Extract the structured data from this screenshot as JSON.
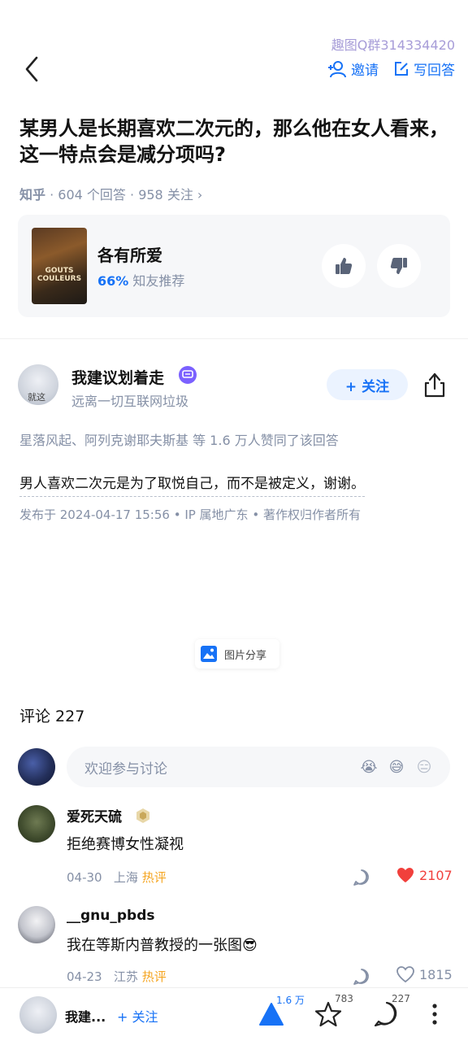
{
  "watermark": "趣图Q群314334420",
  "topbar": {
    "invite_label": "邀请",
    "write_answer_label": "写回答"
  },
  "question": {
    "title": "某男人是长期喜欢二次元的，那么他在女人看来，这一特点会是减分项吗?",
    "source": "知乎",
    "answers": "604 个回答",
    "follows": "958 关注",
    "chevron": "›"
  },
  "recommendation": {
    "poster_text": "GOUTS COULEURS",
    "title": "各有所爱",
    "percent": "66%",
    "percent_suffix": "知友推荐"
  },
  "author": {
    "avatar_text": "就这",
    "name": "我建议划着走",
    "bio": "远离一切互联网垃圾",
    "follow_label": "+ 关注"
  },
  "answer": {
    "voters": "星落风起、阿列克谢耶夫斯基 等 1.6 万人赞同了该回答",
    "text": "男人喜欢二次元是为了取悦自己，而不是被定义，谢谢。",
    "meta": "发布于 2024-04-17 15:56 • IP 属地广东 • 著作权归作者所有",
    "image_share_label": "图片分享"
  },
  "comments": {
    "header": "评论 227",
    "input_placeholder": "欢迎参与讨论",
    "emojis": [
      "😭",
      "😅",
      "😑"
    ],
    "items": [
      {
        "name": "爱死天硫",
        "text": "拒绝赛博女性凝视",
        "date": "04-30",
        "location": "上海",
        "tag": "热评",
        "likes": "2107",
        "liked": true
      },
      {
        "name": "__gnu_pbds",
        "text": "我在等斯内普教授的一张图😎",
        "date": "04-23",
        "location": "江苏",
        "tag": "热评",
        "likes": "1815",
        "liked": false
      }
    ]
  },
  "bottombar": {
    "name": "我建...",
    "follow_label": "+ 关注",
    "upvote_count": "1.6 万",
    "favorite_count": "783",
    "comment_count": "227"
  },
  "colors": {
    "accent": "#1772f6",
    "muted": "#8590a6",
    "hot": "#f5a623",
    "like": "#f1403c"
  }
}
